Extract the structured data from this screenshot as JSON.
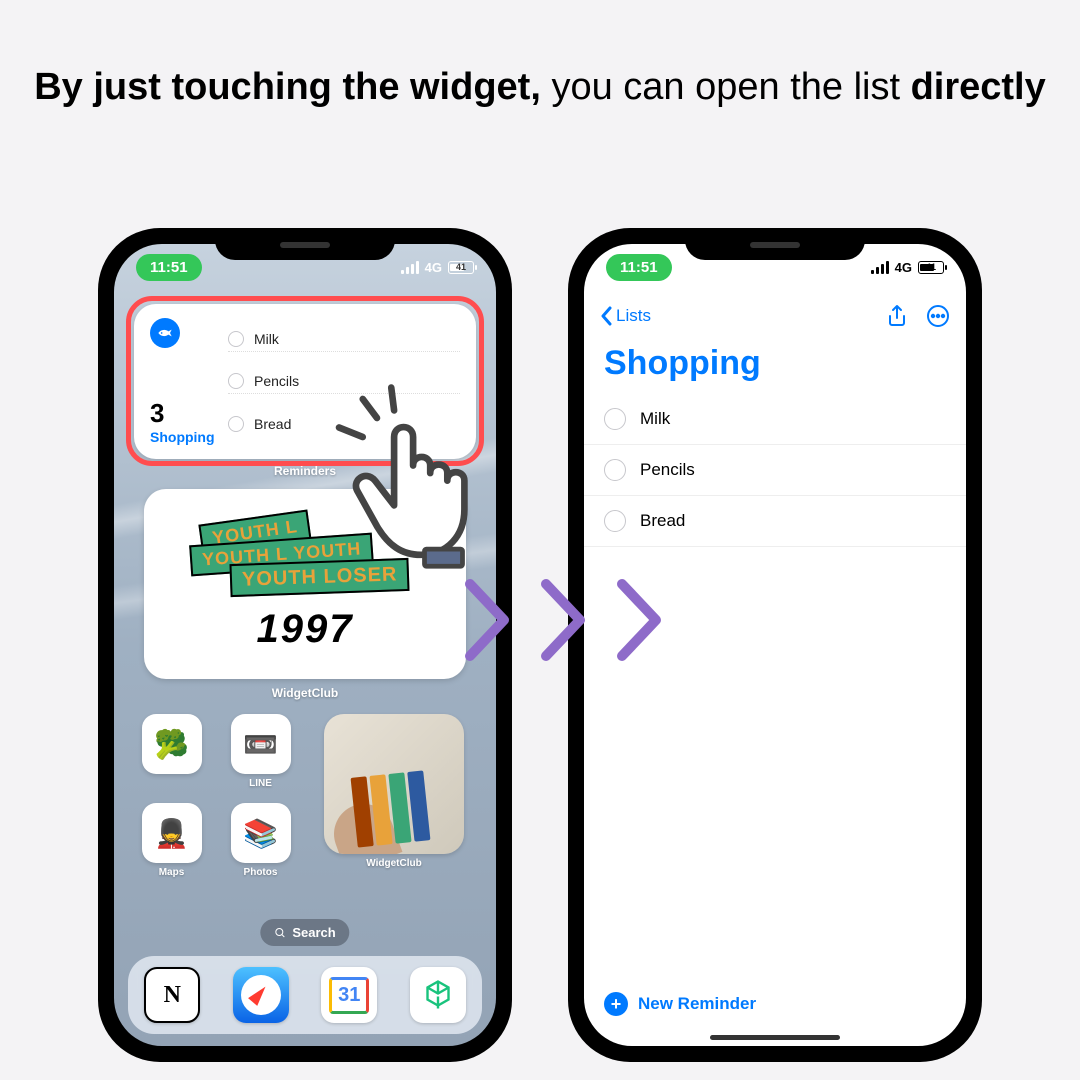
{
  "heading": {
    "b1": "By just touching the widget,",
    "mid": " you can open the list ",
    "b2": "directly"
  },
  "status": {
    "time": "11:51",
    "network": "4G",
    "battery": "41"
  },
  "widget": {
    "count": "3",
    "name": "Shopping",
    "items": [
      "Milk",
      "Pencils",
      "Bread"
    ],
    "label": "Reminders"
  },
  "youth": {
    "sticker1": "YOUTH L",
    "sticker2": "YOUTH L  YOUTH",
    "sticker3": "YOUTH  LOSER",
    "year": "1997",
    "label": "WidgetClub"
  },
  "apps": {
    "a1": {
      "glyph": "🥦",
      "label": ""
    },
    "a2": {
      "glyph": "📼",
      "label": "LINE"
    },
    "a3": {
      "glyph": "💂",
      "label": "Maps"
    },
    "a4": {
      "glyph": "📚",
      "label": "Photos"
    },
    "big": {
      "label": "WidgetClub"
    }
  },
  "search": {
    "label": "Search"
  },
  "dock": {
    "d1": "N",
    "d3": "31"
  },
  "app": {
    "back": "Lists",
    "title": "Shopping",
    "items": [
      "Milk",
      "Pencils",
      "Bread"
    ],
    "new": "New Reminder"
  }
}
